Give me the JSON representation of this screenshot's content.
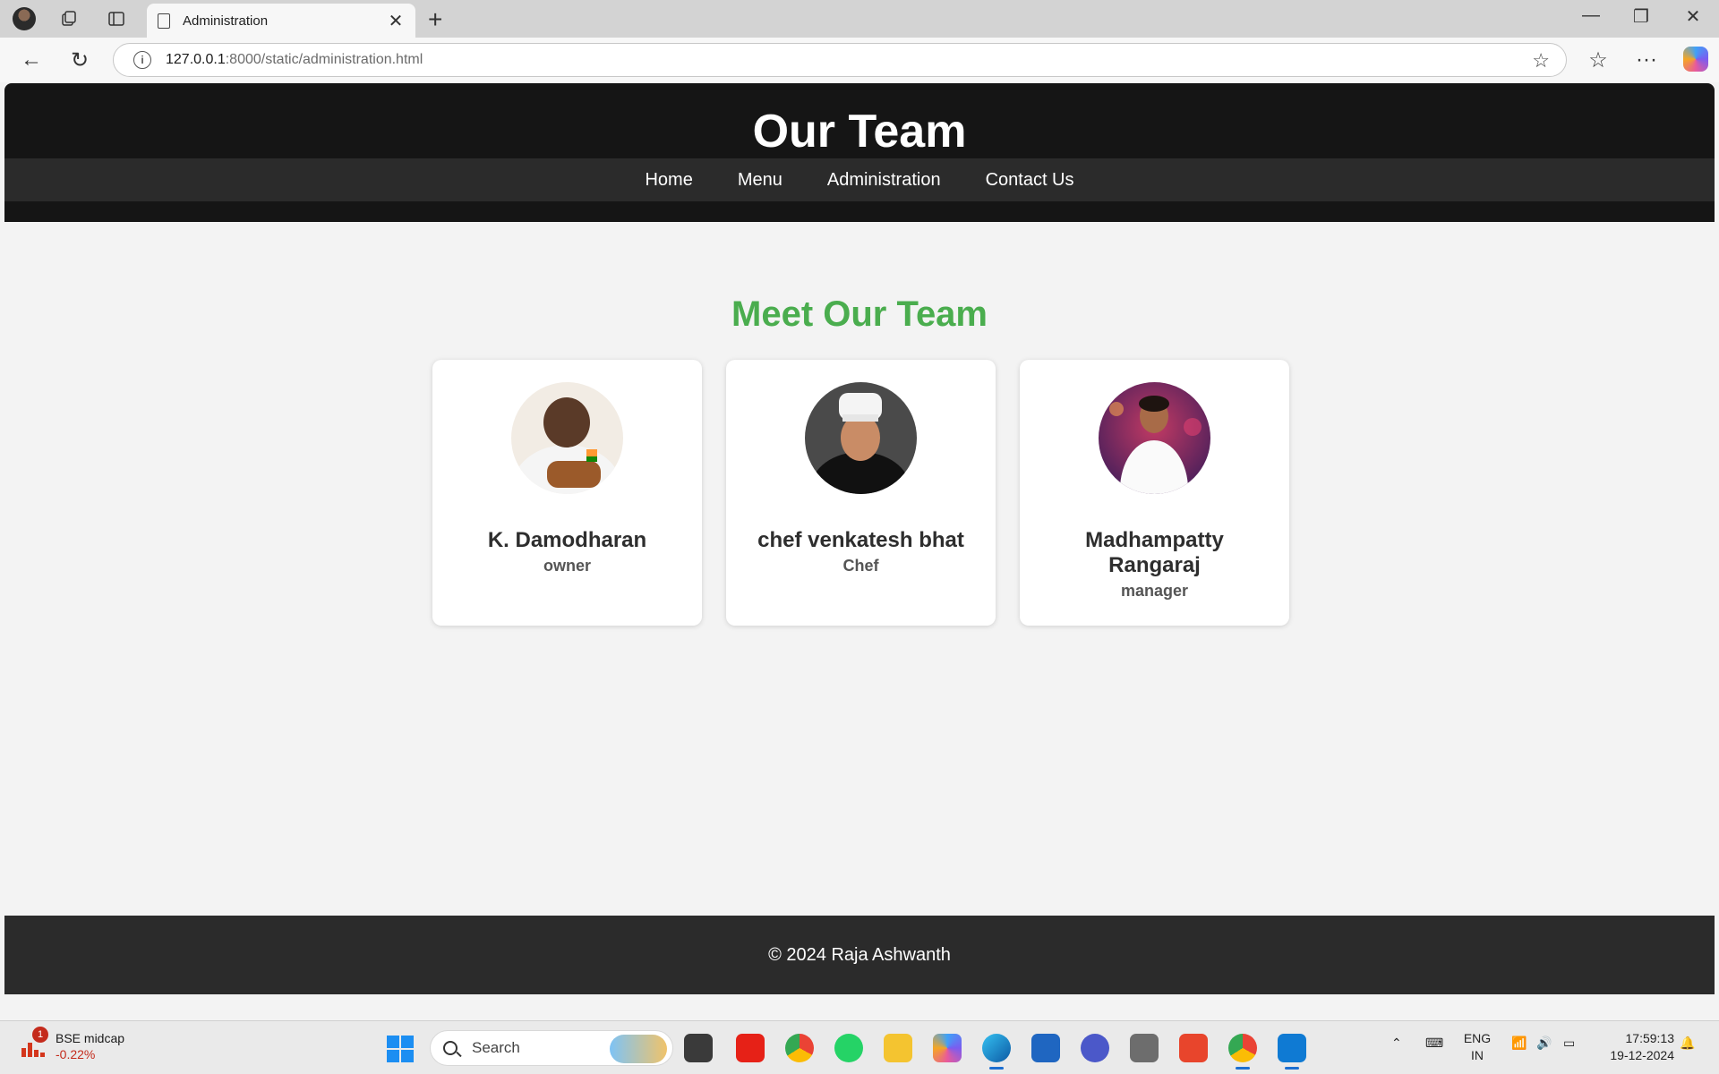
{
  "browser": {
    "tab_title": "Administration",
    "url_host": "127.0.0.1",
    "url_path": ":8000/static/administration.html"
  },
  "site": {
    "title": "Our Team",
    "nav": [
      "Home",
      "Menu",
      "Administration",
      "Contact Us"
    ],
    "section_title": "Meet Our Team",
    "team": [
      {
        "name": "K. Damodharan",
        "role": "owner"
      },
      {
        "name": "chef venkatesh bhat",
        "role": "Chef"
      },
      {
        "name": "Madhampatty Rangaraj",
        "role": "manager"
      }
    ],
    "footer": "© 2024 Raja Ashwanth"
  },
  "taskbar": {
    "widget_name": "BSE midcap",
    "widget_change": "-0.22%",
    "widget_badge": "1",
    "search_placeholder": "Search",
    "lang_line1": "ENG",
    "lang_line2": "IN",
    "time": "17:59:13",
    "date": "19-12-2024"
  },
  "colors": {
    "header_bg": "#151515",
    "nav_bg": "#2b2b2b",
    "accent_green": "#4aad4e",
    "footer_bg": "#2b2b2b"
  }
}
